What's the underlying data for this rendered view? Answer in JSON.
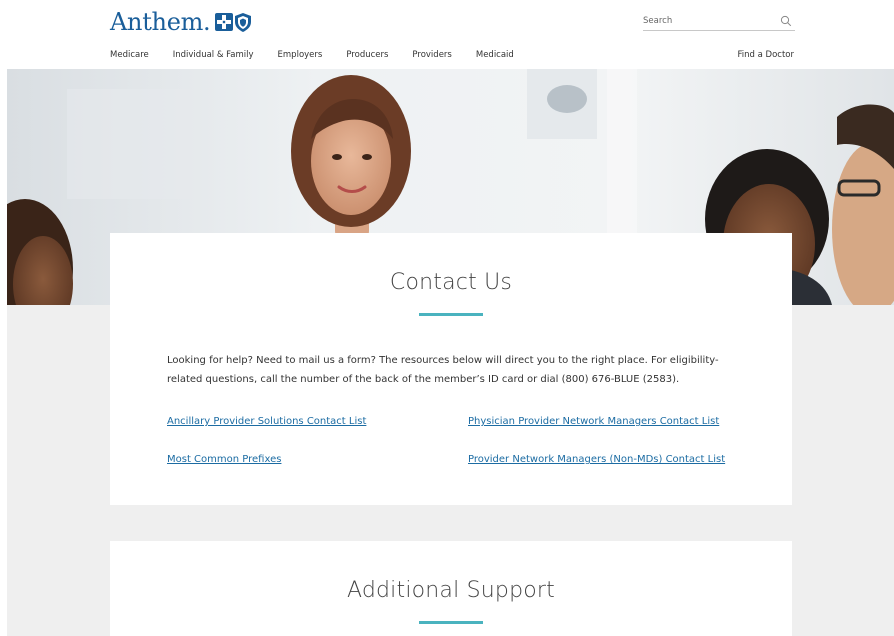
{
  "header": {
    "logo_text": "Anthem.",
    "search_placeholder": "Search",
    "nav": [
      {
        "label": "Medicare"
      },
      {
        "label": "Individual & Family"
      },
      {
        "label": "Employers"
      },
      {
        "label": "Producers"
      },
      {
        "label": "Providers"
      },
      {
        "label": "Medicaid"
      }
    ],
    "find_doctor": "Find a Doctor"
  },
  "brand_colors": {
    "logo_blue": "#1a5e9a",
    "link_blue": "#1c6ca3",
    "accent_teal": "#4ab3bf",
    "band_gray": "#efefef"
  },
  "contact": {
    "title": "Contact Us",
    "intro": "Looking for help? Need to mail us a form? The resources below will direct you to the right place. For eligibility-related questions, call the number of the back of the member’s ID card or dial (800) 676-BLUE (2583).",
    "links": [
      {
        "label": "Ancillary Provider Solutions Contact List"
      },
      {
        "label": "Physician Provider Network Managers Contact List"
      },
      {
        "label": "Most Common Prefixes"
      },
      {
        "label": "Provider Network Managers (Non-MDs) Contact List"
      }
    ]
  },
  "support": {
    "title": "Additional Support"
  },
  "icons": {
    "search": "search-icon",
    "logo_cross": "blue-cross-icon",
    "logo_shield": "blue-shield-icon"
  }
}
